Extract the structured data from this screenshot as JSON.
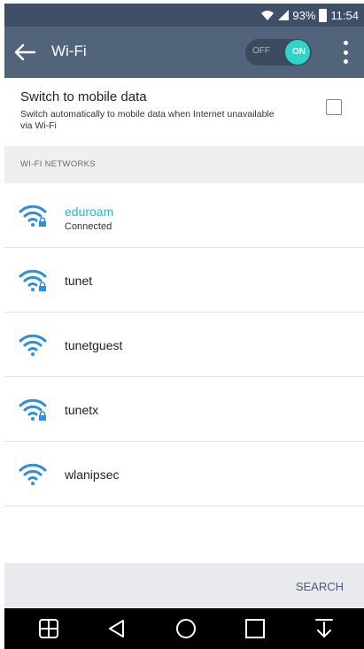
{
  "status_bar": {
    "battery_text": "93%",
    "time": "11:54",
    "icons": [
      "wifi-icon",
      "signal-icon",
      "battery-icon"
    ]
  },
  "app_bar": {
    "title": "Wi-Fi",
    "toggle_off_label": "OFF",
    "toggle_on_label": "ON",
    "wifi_enabled": true
  },
  "mobile_data": {
    "title": "Switch to mobile data",
    "description": "Switch automatically to mobile data when Internet unavailable via Wi-Fi",
    "checked": false
  },
  "section_header": "WI-FI NETWORKS",
  "networks": [
    {
      "name": "eduroam",
      "status": "Connected",
      "secured": true
    },
    {
      "name": "tunet",
      "status": "",
      "secured": true
    },
    {
      "name": "tunetguest",
      "status": "",
      "secured": false
    },
    {
      "name": "tunetx",
      "status": "",
      "secured": true
    },
    {
      "name": "wlanipsec",
      "status": "",
      "secured": false
    }
  ],
  "search_label": "SEARCH",
  "nav_bar": [
    "apps-icon",
    "back-icon",
    "home-icon",
    "recents-icon",
    "notification-icon"
  ],
  "colors": {
    "status_bar": "#3f4f67",
    "app_bar": "#52637c",
    "accent": "#27b6d1",
    "toggle_on": "#2fd3c8",
    "wifi_icon": "#2f8fd9"
  }
}
